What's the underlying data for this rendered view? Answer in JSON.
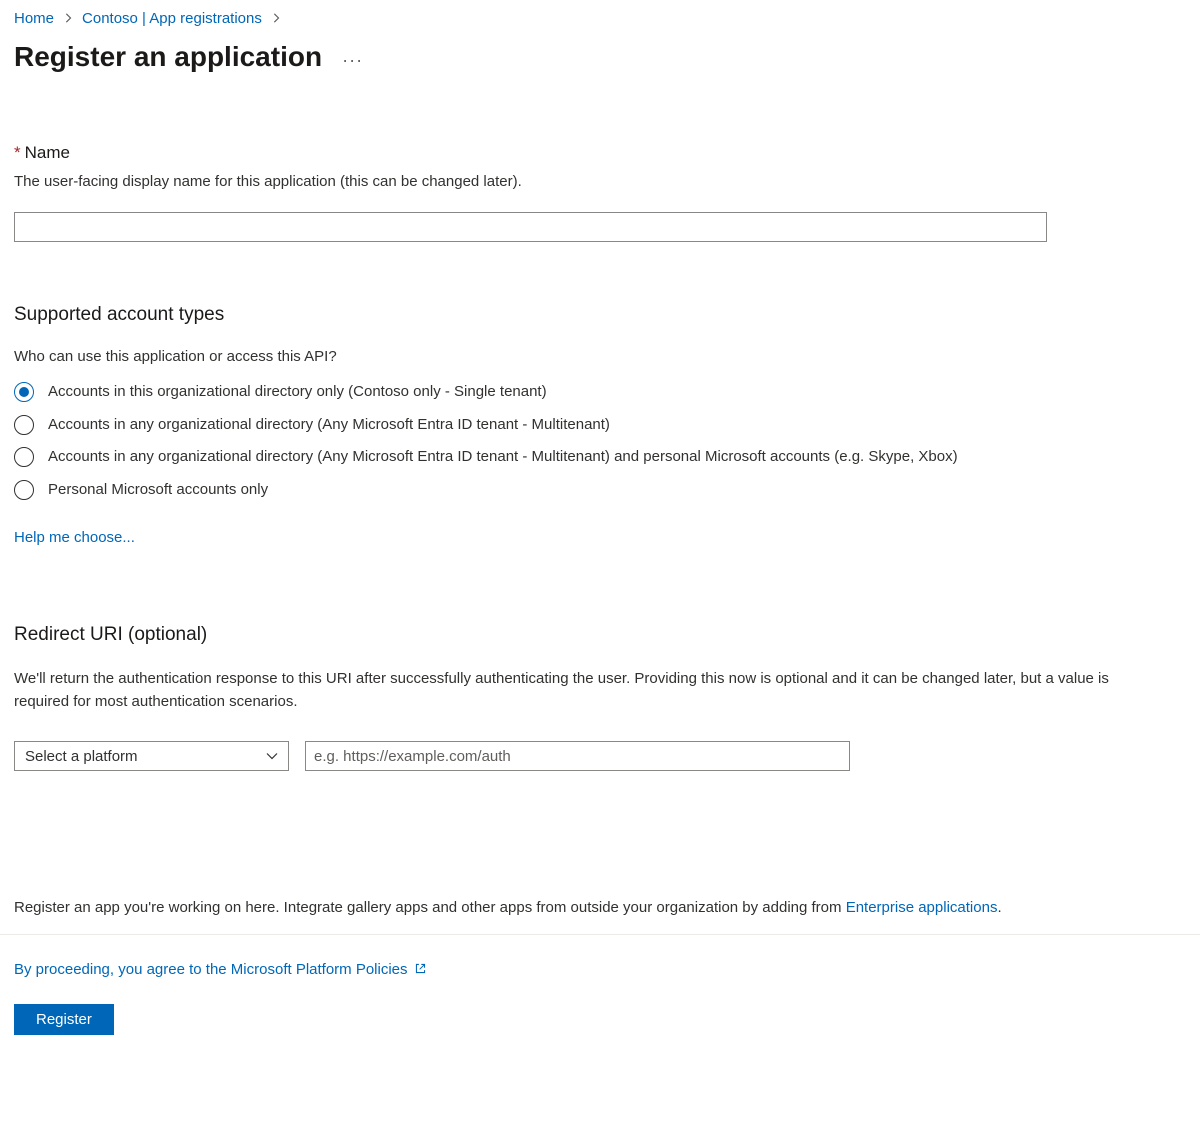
{
  "breadcrumb": {
    "home": "Home",
    "app_registrations": "Contoso | App registrations"
  },
  "page_title": "Register an application",
  "name_section": {
    "label": "Name",
    "description": "The user-facing display name for this application (this can be changed later).",
    "value": ""
  },
  "account_types": {
    "heading": "Supported account types",
    "description": "Who can use this application or access this API?",
    "options": [
      "Accounts in this organizational directory only (Contoso only - Single tenant)",
      "Accounts in any organizational directory (Any Microsoft Entra ID tenant - Multitenant)",
      "Accounts in any organizational directory (Any Microsoft Entra ID tenant - Multitenant) and personal Microsoft accounts (e.g. Skype, Xbox)",
      "Personal Microsoft accounts only"
    ],
    "help_link": "Help me choose..."
  },
  "redirect": {
    "heading": "Redirect URI (optional)",
    "description": "We'll return the authentication response to this URI after successfully authenticating the user. Providing this now is optional and it can be changed later, but a value is required for most authentication scenarios.",
    "platform_placeholder": "Select a platform",
    "uri_placeholder": "e.g. https://example.com/auth"
  },
  "footer": {
    "register_text_pre": "Register an app you're working on here. Integrate gallery apps and other apps from outside your organization by adding from ",
    "enterprise_link": "Enterprise applications",
    "register_text_post": ".",
    "policy_text": "By proceeding, you agree to the Microsoft Platform Policies",
    "button_label": "Register"
  }
}
